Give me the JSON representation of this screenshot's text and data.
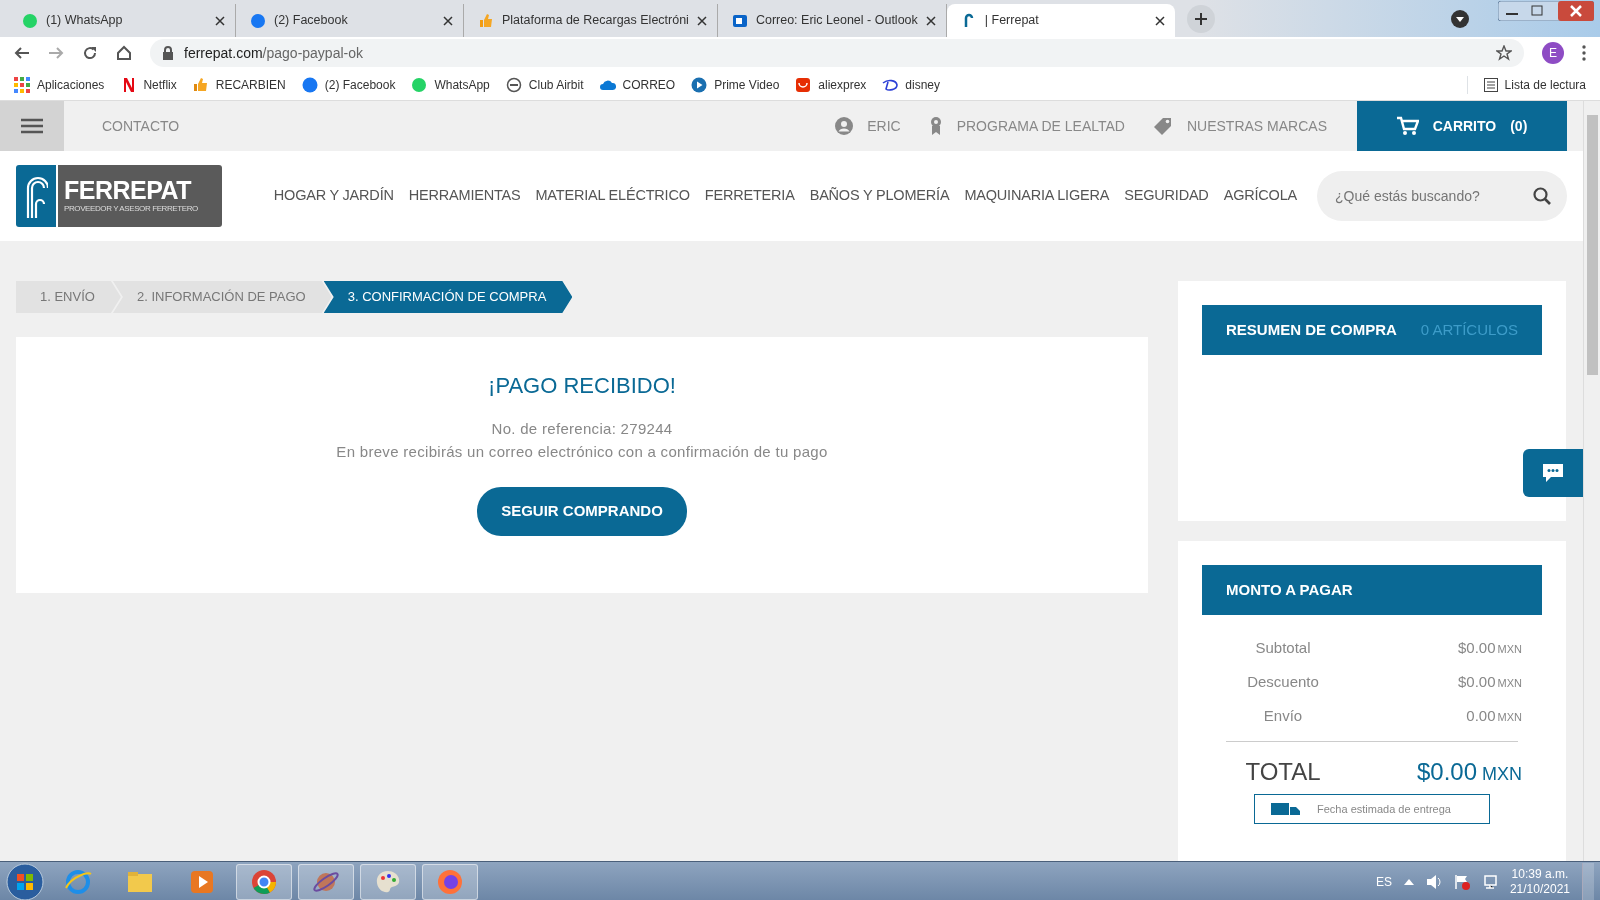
{
  "browser": {
    "tabs": [
      {
        "title": "(1) WhatsApp",
        "selected": false
      },
      {
        "title": "(2) Facebook",
        "selected": false
      },
      {
        "title": "Plataforma de Recargas Electróni",
        "selected": false
      },
      {
        "title": "Correo: Eric Leonel - Outlook",
        "selected": false
      },
      {
        "title": "| Ferrepat",
        "selected": true
      }
    ],
    "profile_initial": "E",
    "url_host": "ferrepat.com",
    "url_path": "/pago-paypal-ok",
    "bookmarks": [
      "Aplicaciones",
      "Netflix",
      "RECARBIEN",
      "(2) Facebook",
      "WhatsApp",
      "Club Airbit",
      "CORREO",
      "Prime Video",
      "aliexprex",
      "disney"
    ],
    "reading_list": "Lista de lectura"
  },
  "top_bar": {
    "contact": "CONTACTO",
    "user": "ERIC",
    "loyalty": "PROGRAMA DE LEALTAD",
    "brands": "NUESTRAS MARCAS",
    "cart": "CARRITO",
    "cart_count": "(0)"
  },
  "logo": {
    "name": "FERREPAT",
    "tagline": "PROVEEDOR Y ASESOR FERRETERO"
  },
  "nav": [
    "HOGAR Y JARDÍN",
    "HERRAMIENTAS",
    "MATERIAL ELÉCTRICO",
    "FERRETERIA",
    "BAÑOS Y PLOMERÍA",
    "MAQUINARIA LIGERA",
    "SEGURIDAD",
    "AGRÍCOLA"
  ],
  "search": {
    "placeholder": "¿Qué estás buscando?"
  },
  "steps": [
    {
      "label": "1. ENVÍO",
      "selected": false
    },
    {
      "label": "2. INFORMACIÓN DE PAGO",
      "selected": false
    },
    {
      "label": "3. CONFIRMACIÓN DE COMPRA",
      "selected": true
    }
  ],
  "confirmation": {
    "title": "¡PAGO RECIBIDO!",
    "reference": "No. de referencia: 279244",
    "message": "En breve recibirás un correo electrónico con a confirmación de tu pago",
    "button": "SEGUIR COMPRANDO"
  },
  "summary": {
    "title": "RESUMEN DE COMPRA",
    "count": "0 ARTÍCULOS"
  },
  "payment": {
    "title": "MONTO A PAGAR",
    "rows": [
      {
        "label": "Subtotal",
        "amount": "$0.00",
        "currency": "MXN"
      },
      {
        "label": "Descuento",
        "amount": "$0.00",
        "currency": "MXN"
      },
      {
        "label": "Envío",
        "amount": "0.00",
        "currency": "MXN"
      }
    ],
    "total": {
      "label": "TOTAL",
      "amount": "$0.00",
      "currency": "MXN"
    },
    "delivery_note": "Fecha estimada de entrega"
  },
  "taskbar": {
    "language": "ES",
    "time": "10:39 a.m.",
    "date": "21/10/2021"
  }
}
